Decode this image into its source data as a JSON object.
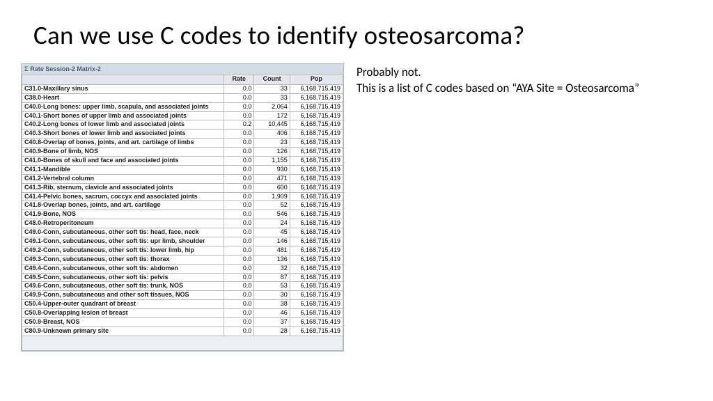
{
  "title": "Can we use C codes to identify osteosarcoma?",
  "panel_title": "Rate Session-2 Matrix-2",
  "columns": {
    "name": "",
    "rate": "Rate",
    "count": "Count",
    "pop": "Pop"
  },
  "rows": [
    {
      "name": "C31.0-Maxillary sinus",
      "rate": "0.0",
      "count": "33",
      "pop": "6,168,715,419"
    },
    {
      "name": "C38.0-Heart",
      "rate": "0.0",
      "count": "33",
      "pop": "6,168,715,419"
    },
    {
      "name": "C40.0-Long bones: upper limb, scapula, and associated joints",
      "rate": "0.0",
      "count": "2,064",
      "pop": "6,168,715,419"
    },
    {
      "name": "C40.1-Short bones of upper limb and associated joints",
      "rate": "0.0",
      "count": "172",
      "pop": "6,168,715,419"
    },
    {
      "name": "C40.2-Long bones of lower limb and associated joints",
      "rate": "0.2",
      "count": "10,445",
      "pop": "6,168,715,419"
    },
    {
      "name": "C40.3-Short bones of lower limb and associated joints",
      "rate": "0.0",
      "count": "406",
      "pop": "6,168,715,419"
    },
    {
      "name": "C40.8-Overlap of bones, joints, and art. cartilage of limbs",
      "rate": "0.0",
      "count": "23",
      "pop": "6,168,715,419"
    },
    {
      "name": "C40.9-Bone of limb, NOS",
      "rate": "0.0",
      "count": "126",
      "pop": "6,168,715,419"
    },
    {
      "name": "C41.0-Bones of skull and face and associated joints",
      "rate": "0.0",
      "count": "1,155",
      "pop": "6,168,715,419"
    },
    {
      "name": "C41.1-Mandible",
      "rate": "0.0",
      "count": "930",
      "pop": "6,168,715,419"
    },
    {
      "name": "C41.2-Vertebral column",
      "rate": "0.0",
      "count": "471",
      "pop": "6,168,715,419"
    },
    {
      "name": "C41.3-Rib, sternum, clavicle and associated joints",
      "rate": "0.0",
      "count": "600",
      "pop": "6,168,715,419"
    },
    {
      "name": "C41.4-Pelvic bones, sacrum, coccyx and associated joints",
      "rate": "0.0",
      "count": "1,909",
      "pop": "6,168,715,419"
    },
    {
      "name": "C41.8-Overlap bones, joints, and art. cartilage",
      "rate": "0.0",
      "count": "52",
      "pop": "6,168,715,419"
    },
    {
      "name": "C41.9-Bone, NOS",
      "rate": "0.0",
      "count": "546",
      "pop": "6,168,715,419"
    },
    {
      "name": "C48.0-Retroperitoneum",
      "rate": "0.0",
      "count": "24",
      "pop": "6,168,715,419"
    },
    {
      "name": "C49.0-Conn, subcutaneous, other soft tis: head, face, neck",
      "rate": "0.0",
      "count": "45",
      "pop": "6,168,715,419"
    },
    {
      "name": "C49.1-Conn, subcutaneous, other soft tis: upr limb, shoulder",
      "rate": "0.0",
      "count": "146",
      "pop": "6,168,715,419"
    },
    {
      "name": "C49.2-Conn, subcutaneous, other soft tis: lower limb, hip",
      "rate": "0.0",
      "count": "481",
      "pop": "6,168,715,419"
    },
    {
      "name": "C49.3-Conn, subcutaneous, other soft tis: thorax",
      "rate": "0.0",
      "count": "136",
      "pop": "6,168,715,419"
    },
    {
      "name": "C49.4-Conn, subcutaneous, other soft tis: abdomen",
      "rate": "0.0",
      "count": "32",
      "pop": "6,168,715,419"
    },
    {
      "name": "C49.5-Conn, subcutaneous, other soft tis: pelvis",
      "rate": "0.0",
      "count": "87",
      "pop": "6,168,715,419"
    },
    {
      "name": "C49.6-Conn, subcutaneous, other soft tis: trunk, NOS",
      "rate": "0.0",
      "count": "53",
      "pop": "6,168,715,419"
    },
    {
      "name": "C49.9-Conn, subcutaneous and other soft tissues, NOS",
      "rate": "0.0",
      "count": "30",
      "pop": "6,168,715,419"
    },
    {
      "name": "C50.4-Upper-outer quadrant of breast",
      "rate": "0.0",
      "count": "38",
      "pop": "6,168,715,419"
    },
    {
      "name": "C50.8-Overlapping lesion of breast",
      "rate": "0.0",
      "count": "46",
      "pop": "6,168,715,419"
    },
    {
      "name": "C50.9-Breast, NOS",
      "rate": "0.0",
      "count": "37",
      "pop": "6,168,715,419"
    },
    {
      "name": "C80.9-Unknown primary site",
      "rate": "0.0",
      "count": "28",
      "pop": "6,168,715,419"
    }
  ],
  "side": {
    "line1": "Probably not.",
    "line2": "This is a list of C codes based on “AYA Site = Osteosarcoma”"
  }
}
